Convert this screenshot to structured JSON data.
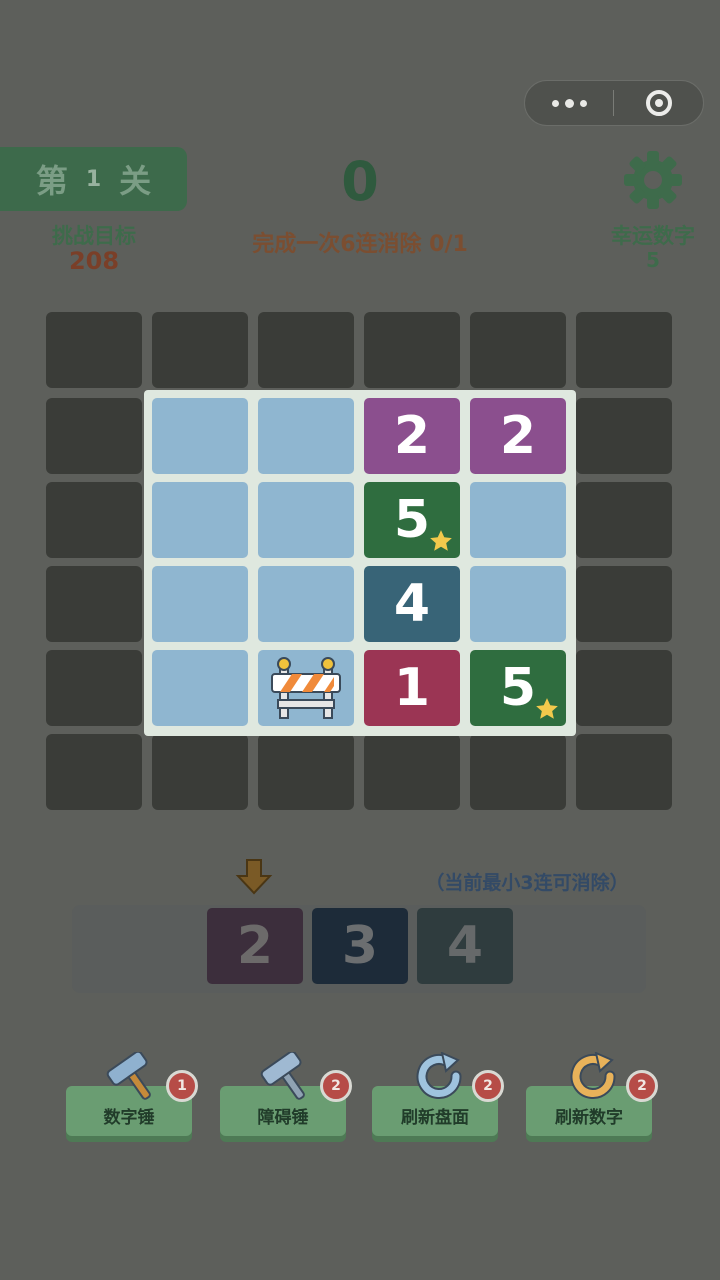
{
  "capsule": {
    "menu_icon": "more-dots-icon",
    "close_icon": "target-close-icon"
  },
  "header": {
    "level_prefix": "第",
    "level_number": "1",
    "level_suffix": "关",
    "score": "0",
    "mission": "完成一次6连消除 0/1",
    "target_label": "挑战目标",
    "target_value": "208",
    "lucky_label": "幸运数字",
    "lucky_value": "5",
    "settings_icon": "gear-icon"
  },
  "board": {
    "rows": 6,
    "cols": 6,
    "tiles": [
      [
        "",
        "",
        "2",
        "2"
      ],
      [
        "",
        "",
        "5★",
        ""
      ],
      [
        "",
        "",
        "4",
        ""
      ],
      [
        "",
        "barrier",
        "1",
        "5★"
      ]
    ],
    "t_r0c2": "2",
    "t_r0c3": "2",
    "t_r1c2": "5",
    "t_r2c2": "4",
    "t_r3c2": "1",
    "t_r3c3": "5"
  },
  "queue": {
    "hint": "（当前最小3连可消除）",
    "items": [
      "2",
      "3",
      "4"
    ]
  },
  "tools": [
    {
      "label": "数字锤",
      "count": "1",
      "icon": "number-hammer-icon"
    },
    {
      "label": "障碍锤",
      "count": "2",
      "icon": "obstacle-hammer-icon"
    },
    {
      "label": "刷新盘面",
      "count": "2",
      "icon": "refresh-board-icon"
    },
    {
      "label": "刷新数字",
      "count": "2",
      "icon": "refresh-number-icon"
    }
  ],
  "colors": {
    "background": "#5d5f5b",
    "tile_empty": "#8fb6d0",
    "tile_2": "#8b4f8e",
    "tile_5": "#2f6d3f",
    "tile_4": "#386477",
    "tile_1": "#9b3554"
  }
}
